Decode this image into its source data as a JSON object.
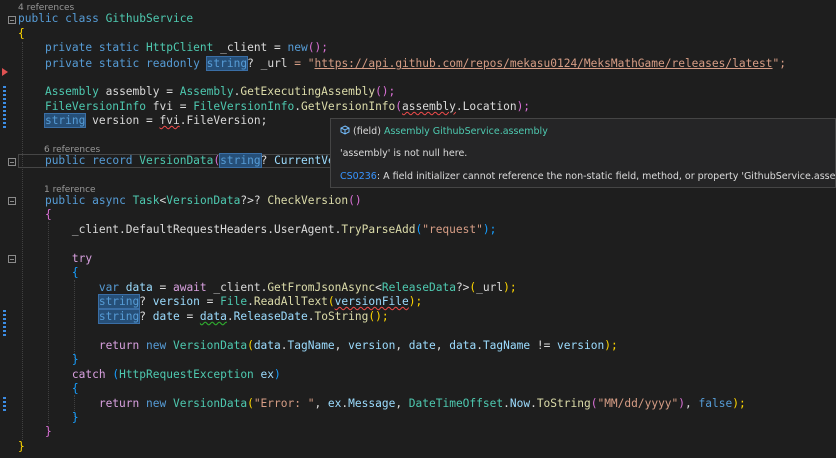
{
  "colors": {
    "background": "#1e1e1e",
    "keyword": "#569cd6",
    "type": "#4ec9b0",
    "method": "#dcdcaa",
    "string": "#d69d85",
    "tooltip_bg": "#252526",
    "error_squiggle": "#f14c4c",
    "change_bar": "#3c8de5"
  },
  "code": {
    "refs_4": "4 references",
    "line1": {
      "kw1": "public",
      "kw2": "class",
      "name": "GithubService"
    },
    "brace_open": "{",
    "line_client": {
      "kw1": "private",
      "kw2": "static",
      "type": "HttpClient",
      "field": "_client",
      "op": " = ",
      "kw3": "new",
      "parens": "();"
    },
    "line_url": {
      "kw1": "private",
      "kw2": "static",
      "kw3": "readonly",
      "type": "string",
      "q": "?",
      "field": "_url",
      "op": " = \"",
      "url": "https://api.github.com/repos/mekasu0124/MeksMathGame/releases/latest",
      "end": "\";"
    },
    "line_asm": {
      "type": "Assembly",
      "field": "assembly",
      "op": " = ",
      "cls": "Assembly",
      "dot": ".",
      "method": "GetExecutingAssembly",
      "end": "();"
    },
    "line_fvi": {
      "type": "FileVersionInfo",
      "field": "fvi",
      "op": " = ",
      "cls": "FileVersionInfo",
      "dot": ".",
      "method": "GetVersionInfo",
      "arg": "assembly",
      "prop": "Location",
      "end": ");"
    },
    "line_ver": {
      "type": "string",
      "field": "version",
      "op": " = ",
      "obj": "fvi",
      "dot": ".",
      "prop": "FileVersion",
      "end": ";"
    },
    "refs_6": "6 references",
    "line_record": {
      "kw1": "public",
      "kw2": "record",
      "name": "VersionData",
      "type": "string",
      "q": "?",
      "param": "CurrentVer"
    },
    "refs_1": "1 reference",
    "line_check": {
      "kw1": "public",
      "kw2": "async",
      "type": "Task",
      "inner": "VersionData",
      "tail": "?>?",
      "method": "CheckVersion",
      "end": "()"
    },
    "line_useragent": {
      "field": "_client",
      "p1": "DefaultRequestHeaders",
      "p2": "UserAgent",
      "method": "TryParseAdd",
      "str": "\"request\"",
      "end": ");"
    },
    "kw_try": "try",
    "line_getjson": {
      "kw": "var",
      "local": "data",
      "op": " = ",
      "kw2": "await",
      "field": "_client",
      "method": "GetFromJsonAsync",
      "typeArg": "ReleaseData",
      "q": "?>",
      "arg": "_url",
      "end": ");"
    },
    "line_readall": {
      "type": "string",
      "q": "?",
      "local": "version",
      "op": " = ",
      "cls": "File",
      "method": "ReadAllText",
      "arg": "versionFile",
      "end": ");"
    },
    "line_date": {
      "type": "string",
      "q": "?",
      "local": "date",
      "op": " = ",
      "obj": "data",
      "prop": "ReleaseDate",
      "method": "ToString",
      "end": "();"
    },
    "line_return1": {
      "kw": "return",
      "kw2": "new",
      "type": "VersionData",
      "a1": "data",
      "p1": "TagName",
      "a2": "version",
      "a3": "date",
      "a4": "data",
      "p4": "TagName",
      "op": " != ",
      "a5": "version",
      "end": ");"
    },
    "line_catch": {
      "kw": "catch",
      "type": "HttpRequestException",
      "var": "ex"
    },
    "line_return2": {
      "kw": "return",
      "kw2": "new",
      "type": "VersionData",
      "str": "\"Error: \"",
      "obj": "ex",
      "prop": "Message",
      "cls": "DateTimeOffset",
      "p2": "Now",
      "method": "ToString",
      "fmt": "\"MM/dd/yyyy\"",
      "kw3": "false",
      "end": ");"
    },
    "brace_close": "}"
  },
  "tooltip": {
    "icon": "field-icon",
    "kind": "(field)",
    "type": "Assembly",
    "member": "GithubService.assembly",
    "null_state": "'assembly' is not null here.",
    "error_code": "CS0236",
    "error_message": ": A field initializer cannot reference the non-static field, method, or property 'GithubService.assembly'"
  }
}
